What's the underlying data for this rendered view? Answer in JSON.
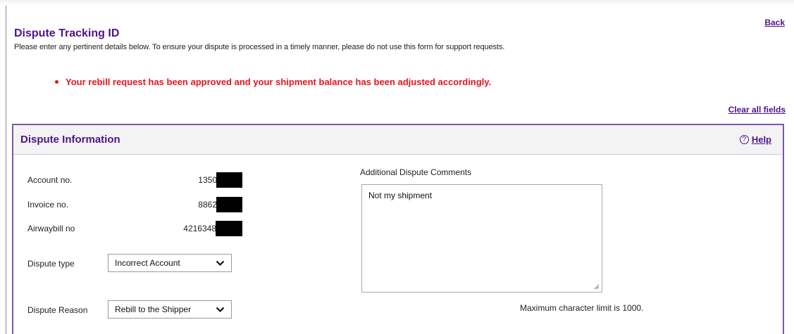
{
  "header": {
    "back_label": "Back",
    "title": "Dispute Tracking ID",
    "subtitle": "Please enter any pertinent details below. To ensure your dispute is processed in a timely manner, please do not use this form for support requests.",
    "clear_label": "Clear all fields"
  },
  "alert": {
    "message": "Your rebill request has been approved and your shipment balance has been adjusted accordingly.",
    "color": "#e8131f"
  },
  "panel": {
    "title": "Dispute Information",
    "help_label": "Help",
    "help_icon": "question-circle-icon",
    "accent": "#4d148c",
    "border": "#7d57b0"
  },
  "fields": {
    "account_label": "Account no.",
    "account_value": "1350",
    "invoice_label": "Invoice no.",
    "invoice_value": "8862",
    "airwaybill_label": "Airwaybill no",
    "airwaybill_value": "4216348",
    "dispute_type_label": "Dispute type",
    "dispute_type_value": "Incorrect Account",
    "dispute_reason_label": "Dispute Reason",
    "dispute_reason_value": "Rebill to the Shipper"
  },
  "comments": {
    "label": "Additional Dispute Comments",
    "value": "Not my shipment",
    "limit_note": "Maximum character limit is 1000."
  }
}
